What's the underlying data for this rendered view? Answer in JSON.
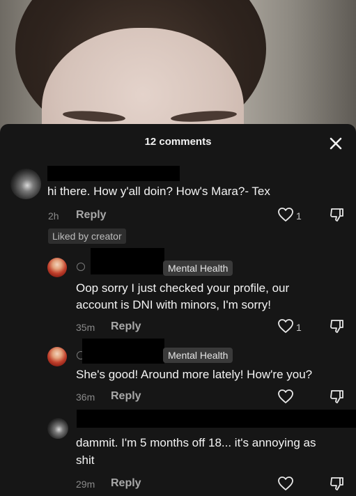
{
  "video": {
    "description_icon": "video-frame"
  },
  "sheet": {
    "comment_count_label": "12 comments",
    "close_icon": "close-icon"
  },
  "comments": [
    {
      "text": "hi there. How y'all doin? How's Mara?- Tex",
      "time": "2h",
      "reply_label": "Reply",
      "like_count": "1",
      "liked_by_creator_label": "Liked by creator"
    },
    {
      "badge": "Mental Health",
      "text_line1": "Oop sorry I just checked your profile, our",
      "text_line2": "account is DNI with minors, I'm sorry!",
      "time": "35m",
      "reply_label": "Reply",
      "like_count": "1"
    },
    {
      "badge": "Mental Health",
      "text": "She's good! Around more lately! How're you?",
      "time": "36m",
      "reply_label": "Reply",
      "like_count": ""
    },
    {
      "text_line1": "dammit. I'm 5 months off 18... it's annoying as",
      "text_line2": "shit",
      "time": "29m",
      "reply_label": "Reply",
      "like_count": ""
    }
  ],
  "colors": {
    "sheet_bg": "#161616",
    "badge_bg": "#3a3a3a",
    "muted_text": "#a8a8a8"
  }
}
